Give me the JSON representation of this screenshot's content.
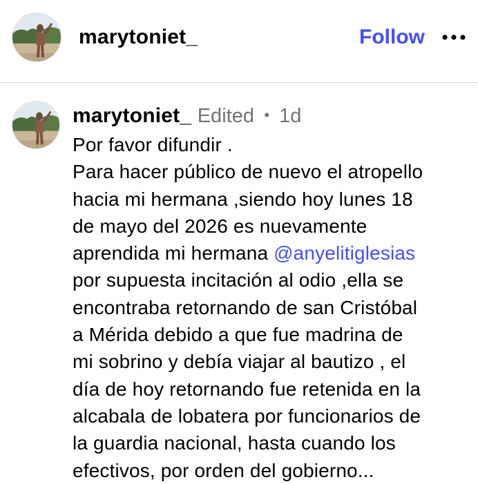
{
  "header": {
    "username": "marytoniet_",
    "follow_label": "Follow",
    "more_icon": "more-horizontal-icon"
  },
  "comment": {
    "username": "marytoniet_",
    "edited_label": "Edited",
    "separator": "•",
    "timestamp": "1d",
    "lines": [
      "Por favor difundir .",
      "Para hacer público de nuevo el atropello",
      "hacia mi hermana ,siendo hoy lunes 18",
      "de mayo del 2026 es nuevamente",
      "aprendida mi hermana ",
      "por supuesta incitación al odio ,ella se",
      "encontraba retornando de san Cristóbal",
      "a Mérida debido a que fue madrina de",
      "mi sobrino y debía viajar al bautizo , el",
      "día de hoy retornando fue retenida en la",
      "alcabala de lobatera por funcionarios de",
      "la guardia nacional, hasta cuando los",
      "efectivos, por orden del gobierno..."
    ],
    "mention": "@anyelitiglesias"
  },
  "colors": {
    "accent": "#4150f7",
    "secondary_text": "#737373",
    "divider": "#dbdbdb"
  }
}
